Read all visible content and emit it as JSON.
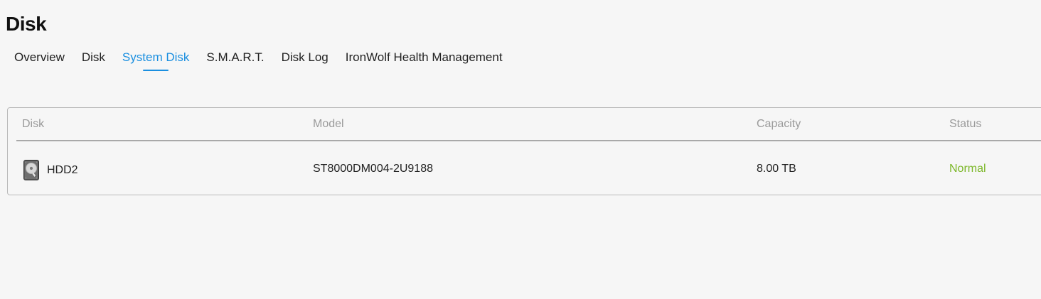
{
  "page": {
    "title": "Disk"
  },
  "tabs": [
    {
      "label": "Overview",
      "active": false
    },
    {
      "label": "Disk",
      "active": false
    },
    {
      "label": "System Disk",
      "active": true
    },
    {
      "label": "S.M.A.R.T.",
      "active": false
    },
    {
      "label": "Disk Log",
      "active": false
    },
    {
      "label": "IronWolf Health Management",
      "active": false
    }
  ],
  "table": {
    "columns": {
      "disk": "Disk",
      "model": "Model",
      "capacity": "Capacity",
      "status": "Status"
    },
    "rows": [
      {
        "icon": "hard-drive-icon",
        "disk": "HDD2",
        "model": "ST8000DM004-2U9188",
        "capacity": "8.00 TB",
        "status": "Normal"
      }
    ]
  },
  "colors": {
    "accent": "#1a8fe0",
    "status_normal": "#7cb728",
    "header_text": "#9a9a9a",
    "background": "#f6f6f6"
  }
}
